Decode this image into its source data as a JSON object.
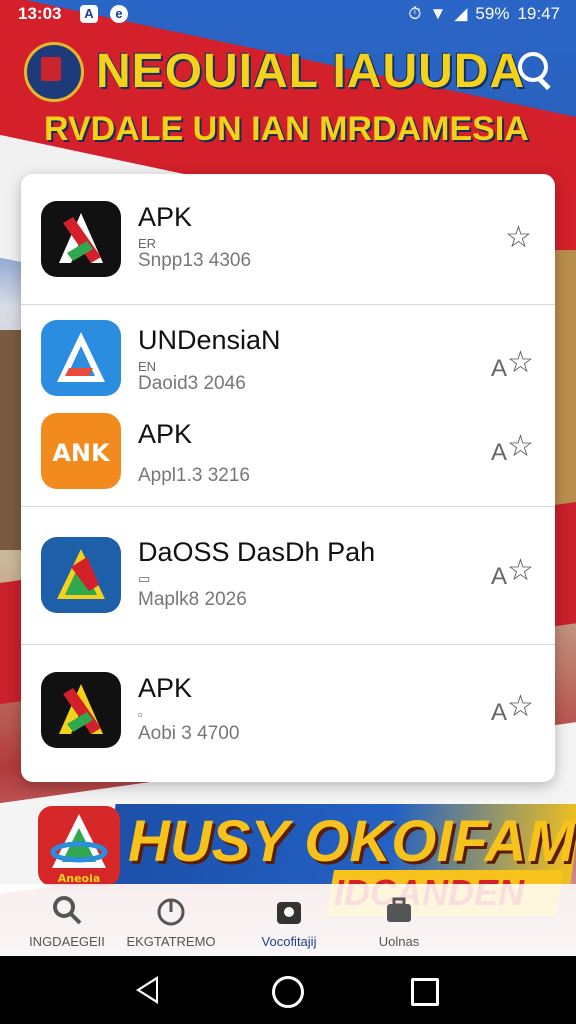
{
  "status_bar": {
    "time_left": "13:03",
    "app_icons": [
      "A",
      "e"
    ],
    "battery": "59%",
    "time_right": "19:47"
  },
  "header": {
    "title": "NEOUIAL IAUUDA",
    "subtitle": "RVDALE UN IAN MRDAMESIA"
  },
  "apps": [
    {
      "name": "APK",
      "meta": "ER",
      "sub": "Snpp13 4306",
      "star_prefix": "",
      "icon": "apk-logo-icon",
      "icon_color": "#111111"
    },
    {
      "name": "UNDensiaN",
      "meta": "EN",
      "sub": "Daoid3 2046",
      "star_prefix": "A",
      "icon": "triangle-logo-icon",
      "icon_color": "#2a8de0"
    },
    {
      "name": "APK",
      "meta": "",
      "sub": "Appl1.3 3216",
      "star_prefix": "A",
      "icon": "anik-logo-icon",
      "icon_color": "#f28a1e"
    },
    {
      "name": "DaOSS DasDh Pah",
      "meta": "▭",
      "sub": "Maplk8 2026",
      "star_prefix": "A",
      "icon": "triangle-logo-icon",
      "icon_color": "#1d5fa8"
    },
    {
      "name": "APK",
      "meta": "▫",
      "sub": "Aobi 3 4700",
      "star_prefix": "A",
      "icon": "apk-logo-icon",
      "icon_color": "#111111"
    }
  ],
  "banner": {
    "title": "HUSY OKOIFAM",
    "sub": "IDCANDEN",
    "icon_label": "Aneola"
  },
  "bottom_nav": [
    {
      "label": "INGDAEGEII",
      "icon": "search-icon",
      "active": false
    },
    {
      "label": "EKGTATREMO",
      "icon": "gauge-icon",
      "active": false
    },
    {
      "label": "Vocofitajij",
      "icon": "bag-icon",
      "active": true
    },
    {
      "label": "Uolnas",
      "icon": "briefcase-icon",
      "active": false
    }
  ]
}
